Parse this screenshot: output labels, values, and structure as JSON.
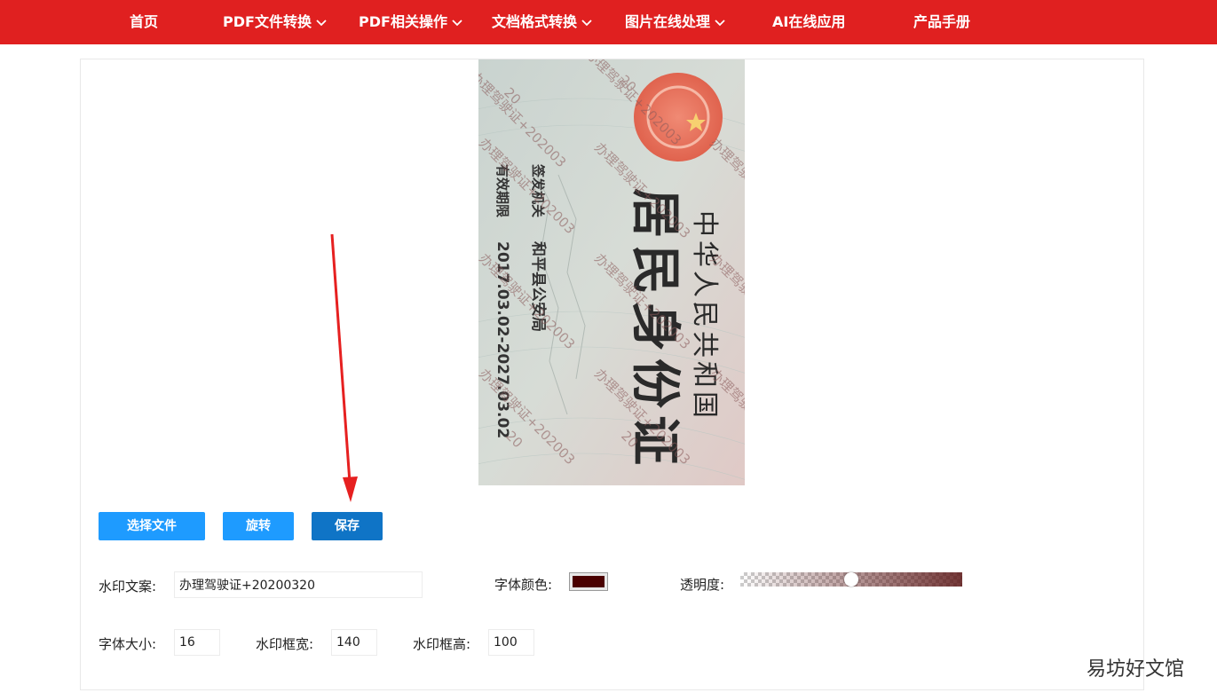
{
  "nav": {
    "items": [
      {
        "label": "首页",
        "has_dropdown": false
      },
      {
        "label": "PDF文件转换",
        "has_dropdown": true
      },
      {
        "label": "PDF相关操作",
        "has_dropdown": true
      },
      {
        "label": "文档格式转换",
        "has_dropdown": true
      },
      {
        "label": "图片在线处理",
        "has_dropdown": true
      },
      {
        "label": "AI在线应用",
        "has_dropdown": false
      },
      {
        "label": "产品手册",
        "has_dropdown": false
      }
    ],
    "color": "#e02020"
  },
  "preview": {
    "card": {
      "country": "中华人民共和国",
      "title": "居民身份证",
      "issuer_label": "签发机关",
      "issuer_value": "和平县公安局",
      "validity_label": "有效期限",
      "validity_value": "2017.03.02-2027.03.02"
    },
    "watermark_text": "办理驾驶证+202003",
    "watermark_fragment": "20"
  },
  "buttons": {
    "choose_file": "选择文件",
    "rotate": "旋转",
    "save": "保存"
  },
  "form": {
    "watermark_text_label": "水印文案:",
    "watermark_text_value": "办理驾驶证+20200320",
    "font_color_label": "字体颜色:",
    "font_color_value": "#4a0000",
    "opacity_label": "透明度:",
    "opacity_value": 0.5,
    "font_size_label": "字体大小:",
    "font_size_value": "16",
    "box_width_label": "水印框宽:",
    "box_width_value": "140",
    "box_height_label": "水印框高:",
    "box_height_value": "100"
  },
  "site_watermark": "易坊好文馆",
  "colors": {
    "button_light": "#1e9bff",
    "button_dark": "#0f74c6",
    "arrow": "#e62020"
  }
}
